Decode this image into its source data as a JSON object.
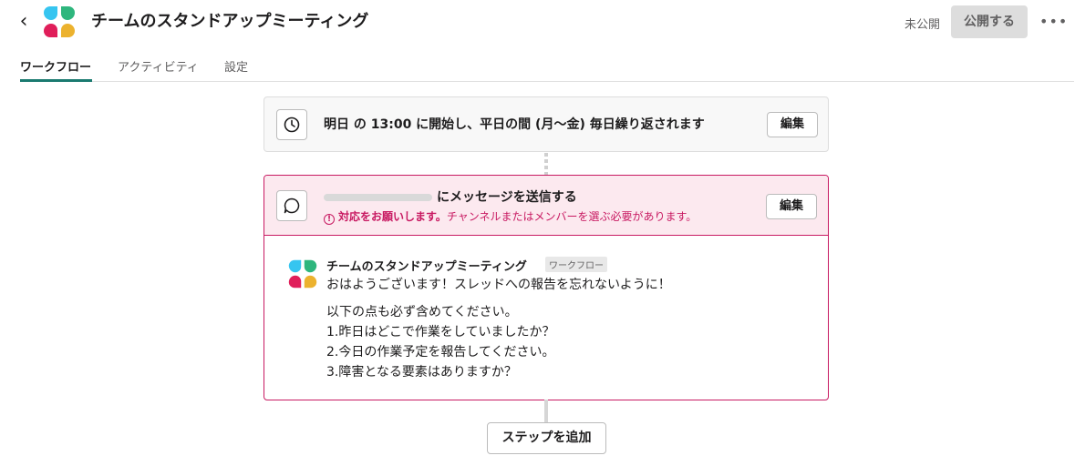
{
  "header": {
    "title": "チームのスタンドアップミーティング",
    "status": "未公開",
    "publish_label": "公開する"
  },
  "tabs": [
    {
      "label": "ワークフロー",
      "active": true
    },
    {
      "label": "アクティビティ",
      "active": false
    },
    {
      "label": "設定",
      "active": false
    }
  ],
  "trigger": {
    "text": "明日 の 13:00 に開始し、平日の間 (月〜金) 毎日繰り返されます",
    "edit_label": "編集"
  },
  "step": {
    "title": "にメッセージを送信する",
    "warning_strong": "対応をお願いします。",
    "warning_text": "チャンネルまたはメンバーを選ぶ必要があります。",
    "edit_label": "編集",
    "preview": {
      "sender": "チームのスタンドアップミーティング",
      "badge": "ワークフロー",
      "lines": [
        "おはようございます！スレッドへの報告を忘れないように！",
        "以下の点も必ず含めてください。",
        "1.昨日はどこで作業をしていましたか？",
        "2.今日の作業予定を報告してください。",
        "3.障害となる要素はありますか？"
      ]
    }
  },
  "add_step_label": "ステップを追加",
  "colors": {
    "accent_tab": "#1a7a70",
    "error": "#c81a62",
    "error_bg": "#fce9ef",
    "logo_blue": "#36c5f0",
    "logo_green": "#2eb67d",
    "logo_red": "#e01e5a",
    "logo_yellow": "#ecb22e"
  },
  "icons": {
    "back": "chevron-left-icon",
    "more": "more-horizontal-icon",
    "trigger": "clock-icon",
    "step": "message-bubble-icon",
    "warning": "warning-circle-icon"
  }
}
